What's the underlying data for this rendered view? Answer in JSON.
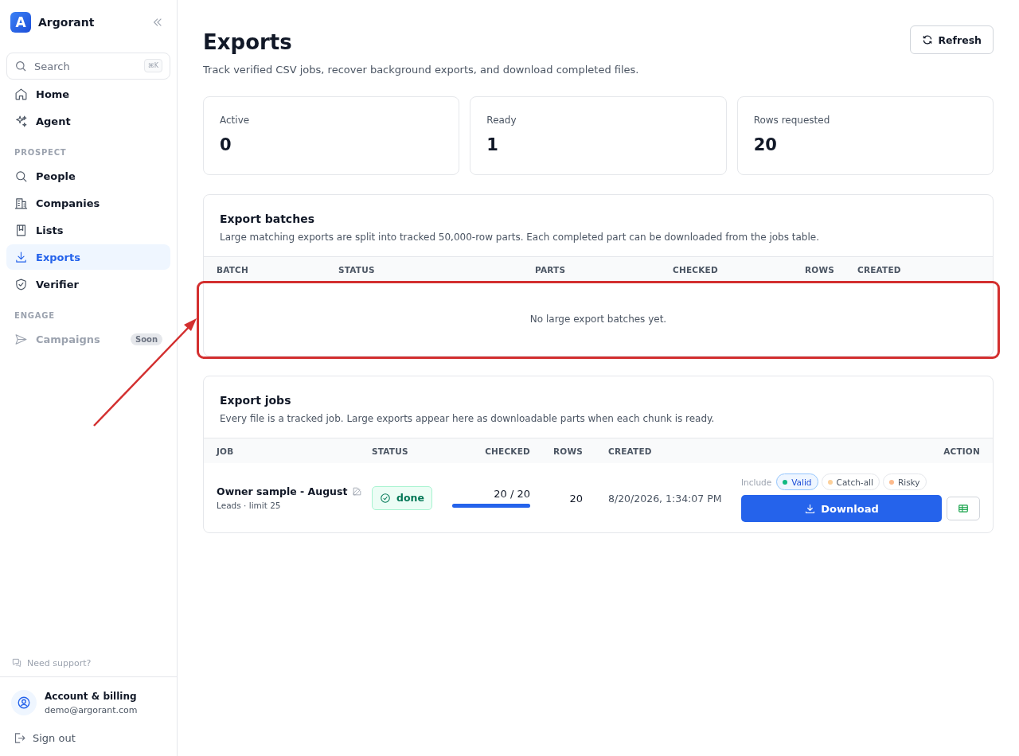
{
  "sidebar": {
    "brand": {
      "logo_text": "A",
      "name": "Argorant"
    },
    "search": {
      "placeholder": "Search",
      "shortcut": "⌘K"
    },
    "sections": [
      {
        "items": [
          {
            "label": "Home",
            "selected": false,
            "disabled": false
          },
          {
            "label": "Agent",
            "selected": false,
            "disabled": false
          }
        ]
      },
      {
        "heading": "PROSPECT",
        "items": [
          {
            "label": "People",
            "selected": false,
            "disabled": false
          },
          {
            "label": "Companies",
            "selected": false,
            "disabled": false
          },
          {
            "label": "Lists",
            "selected": false,
            "disabled": false
          },
          {
            "label": "Exports",
            "selected": true,
            "disabled": false
          },
          {
            "label": "Verifier",
            "selected": false,
            "disabled": false
          }
        ]
      },
      {
        "heading": "ENGAGE",
        "items": [
          {
            "label": "Campaigns",
            "selected": false,
            "disabled": true,
            "badge": "Soon"
          }
        ]
      }
    ],
    "support": "Need support?",
    "account": {
      "name": "Account & billing",
      "email": "demo@argorant.com"
    },
    "sign_out": "Sign out"
  },
  "header": {
    "title": "Exports",
    "subtitle": "Track verified CSV jobs, recover background exports, and download completed files.",
    "refresh": "Refresh"
  },
  "stats": [
    {
      "label": "Active",
      "value": "0"
    },
    {
      "label": "Ready",
      "value": "1"
    },
    {
      "label": "Rows requested",
      "value": "20"
    }
  ],
  "batches": {
    "title": "Export batches",
    "description": "Large matching exports are split into tracked 50,000-row parts. Each completed part can be downloaded from the jobs table.",
    "columns": [
      "BATCH",
      "STATUS",
      "PARTS",
      "CHECKED",
      "ROWS",
      "CREATED"
    ],
    "empty_text": "No large export batches yet."
  },
  "jobs": {
    "title": "Export jobs",
    "description": "Every file is a tracked job. Large exports appear here as downloadable parts when each chunk is ready.",
    "columns": [
      "JOB",
      "STATUS",
      "CHECKED",
      "ROWS",
      "CREATED",
      "ACTION"
    ],
    "rows": [
      {
        "name": "Owner sample - August",
        "meta": "Leads · limit 25",
        "status": "done",
        "checked": "20 / 20",
        "level": 1,
        "rows": "20",
        "created": "8/20/2026, 1:34:07 PM",
        "include_label": "Include",
        "filters": [
          {
            "label": "Valid",
            "selected": true,
            "color": "#10b981"
          },
          {
            "label": "Catch-all",
            "selected": false,
            "color": "#fcd09a"
          },
          {
            "label": "Risky",
            "selected": false,
            "color": "#fdba8c"
          }
        ],
        "action": "Download"
      }
    ]
  },
  "annotation": {
    "kind": "highlight"
  }
}
